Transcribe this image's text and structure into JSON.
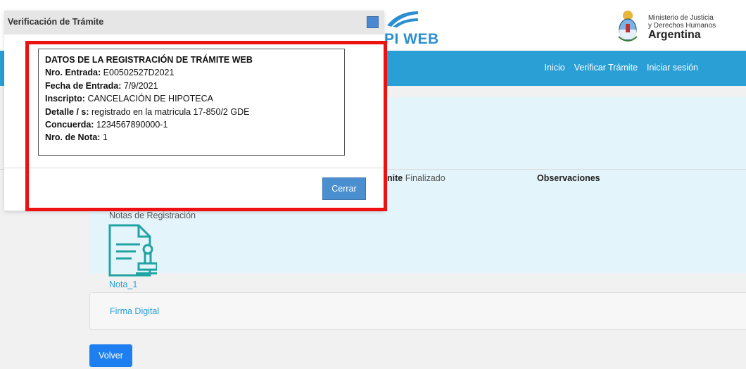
{
  "header": {
    "logo_text": "PI WEB",
    "ministry_line1": "Ministerio de Justicia",
    "ministry_line2": "y Derechos Humanos",
    "ministry_line3": "Argentina"
  },
  "nav": {
    "items": [
      "Inicio",
      "Verificar Trámite",
      "Iniciar sesión"
    ]
  },
  "tramite": {
    "estado_label": "nite",
    "estado_value": "Finalizado",
    "observaciones_label": "Observaciones"
  },
  "notas": {
    "label": "Notas de Registración",
    "note_link": "Nota_1"
  },
  "firma": {
    "link": "Firma Digital"
  },
  "volver_label": "Volver",
  "dialog": {
    "title": "Verificación de Trámite",
    "box_title": "DATOS DE LA REGISTRACIÓN DE TRÁMITE WEB",
    "rows": [
      {
        "label": "Nro. Entrada:",
        "value": "E00502527D2021"
      },
      {
        "label": "Fecha de Entrada:",
        "value": "7/9/2021"
      },
      {
        "label": "Inscripto:",
        "value": "CANCELACIÓN DE HIPOTECA"
      },
      {
        "label": "Detalle / s:",
        "value": "registrado en la matrícula 17-850/2  GDE"
      },
      {
        "label": "Concuerda:",
        "value": "1234567890000-1"
      },
      {
        "label": "Nro. de Nota:",
        "value": "1"
      }
    ],
    "close_label": "Cerrar"
  },
  "colors": {
    "navbar": "#2a9fd6",
    "highlight": "#ee1111",
    "button_primary": "#1e7ff0",
    "info_panel": "#e4f4fb"
  }
}
